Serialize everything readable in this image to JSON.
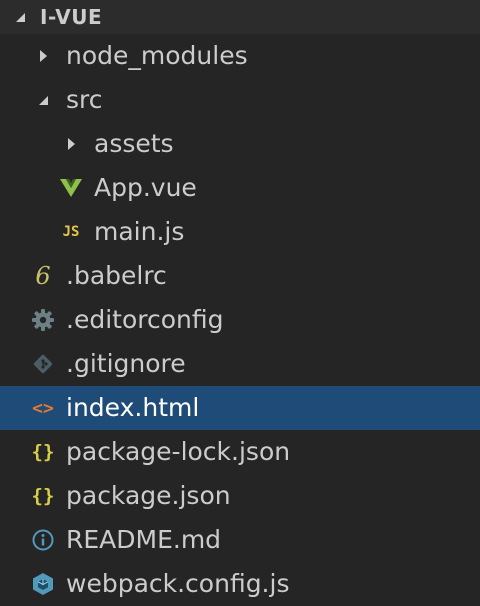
{
  "explorer": {
    "section_title": "I-VUE",
    "items": [
      {
        "label": "node_modules",
        "kind": "folder",
        "state": "collapsed",
        "icon": "chevron-right-icon"
      },
      {
        "label": "src",
        "kind": "folder",
        "state": "expanded",
        "icon": "chevron-down-icon"
      },
      {
        "label": "assets",
        "kind": "folder",
        "state": "collapsed",
        "icon": "chevron-right-icon"
      },
      {
        "label": "App.vue",
        "kind": "file",
        "icon": "vue-icon"
      },
      {
        "label": "main.js",
        "kind": "file",
        "icon": "javascript-icon",
        "badge": "JS"
      },
      {
        "label": ".babelrc",
        "kind": "file",
        "icon": "babel-icon",
        "badge": "6"
      },
      {
        "label": ".editorconfig",
        "kind": "file",
        "icon": "gear-icon"
      },
      {
        "label": ".gitignore",
        "kind": "file",
        "icon": "git-icon"
      },
      {
        "label": "index.html",
        "kind": "file",
        "icon": "html-icon",
        "badge": "<>",
        "selected": true
      },
      {
        "label": "package-lock.json",
        "kind": "file",
        "icon": "json-icon",
        "badge": "{}"
      },
      {
        "label": "package.json",
        "kind": "file",
        "icon": "json-icon",
        "badge": "{}"
      },
      {
        "label": "README.md",
        "kind": "file",
        "icon": "info-icon"
      },
      {
        "label": "webpack.config.js",
        "kind": "file",
        "icon": "webpack-icon"
      }
    ]
  },
  "colors": {
    "background": "#252526",
    "header_background": "#2c2c2d",
    "selection": "#1e4b78",
    "text": "#cccccc",
    "vue_green": "#8dc149",
    "js_yellow": "#e5c44a",
    "json_yellow": "#d9cf47",
    "html_orange": "#e37933",
    "info_blue": "#519aba",
    "webpack_blue": "#519aba",
    "muted_gray": "#6d8086"
  }
}
